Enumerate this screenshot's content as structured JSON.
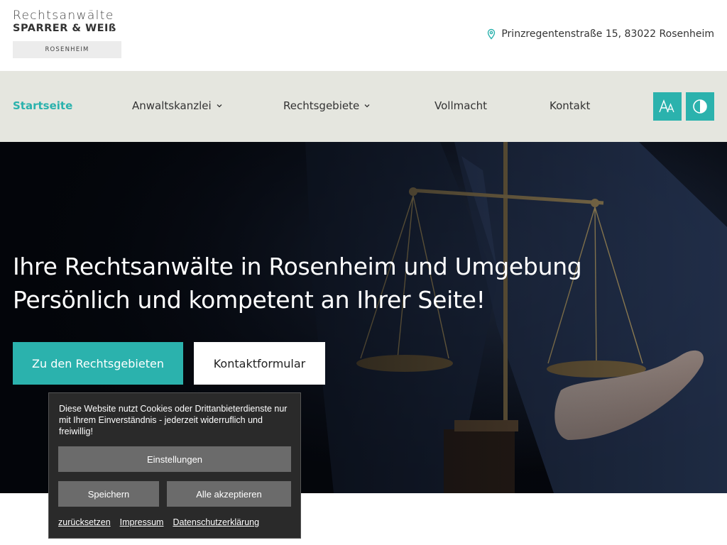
{
  "logo": {
    "line1": "Rechtsanwälte",
    "line2": "SPARRER & WEIß",
    "line3": "ROSENHEIM"
  },
  "header": {
    "address": "Prinzregentenstraße 15, 83022 Rosenheim",
    "address_icon": "location-pin-icon"
  },
  "nav": {
    "items": [
      {
        "label": "Startseite",
        "active": true
      },
      {
        "label": "Anwaltskanzlei",
        "dropdown": true
      },
      {
        "label": "Rechtsgebiete",
        "dropdown": true
      },
      {
        "label": "Vollmacht"
      },
      {
        "label": "Kontakt"
      }
    ],
    "font_size_button": "AA",
    "accent": "#2bb2ad"
  },
  "hero": {
    "title": "Ihre Rechtsanwälte in Rosenheim und Umgebung",
    "subtitle": "Persönlich und kompetent an Ihrer Seite!",
    "primary_button": "Zu den Rechtsgebieten",
    "secondary_button": "Kontaktformular"
  },
  "cookie": {
    "text": "Diese Website nutzt Cookies oder Drittanbieterdienste nur mit Ihrem Einverständnis - jederzeit widerruflich und freiwillig!",
    "settings_button": "Einstellungen",
    "save_button": "Speichern",
    "accept_all_button": "Alle akzeptieren",
    "links": [
      "zurücksetzen",
      "Impressum",
      "Datenschutzerklärung"
    ]
  }
}
